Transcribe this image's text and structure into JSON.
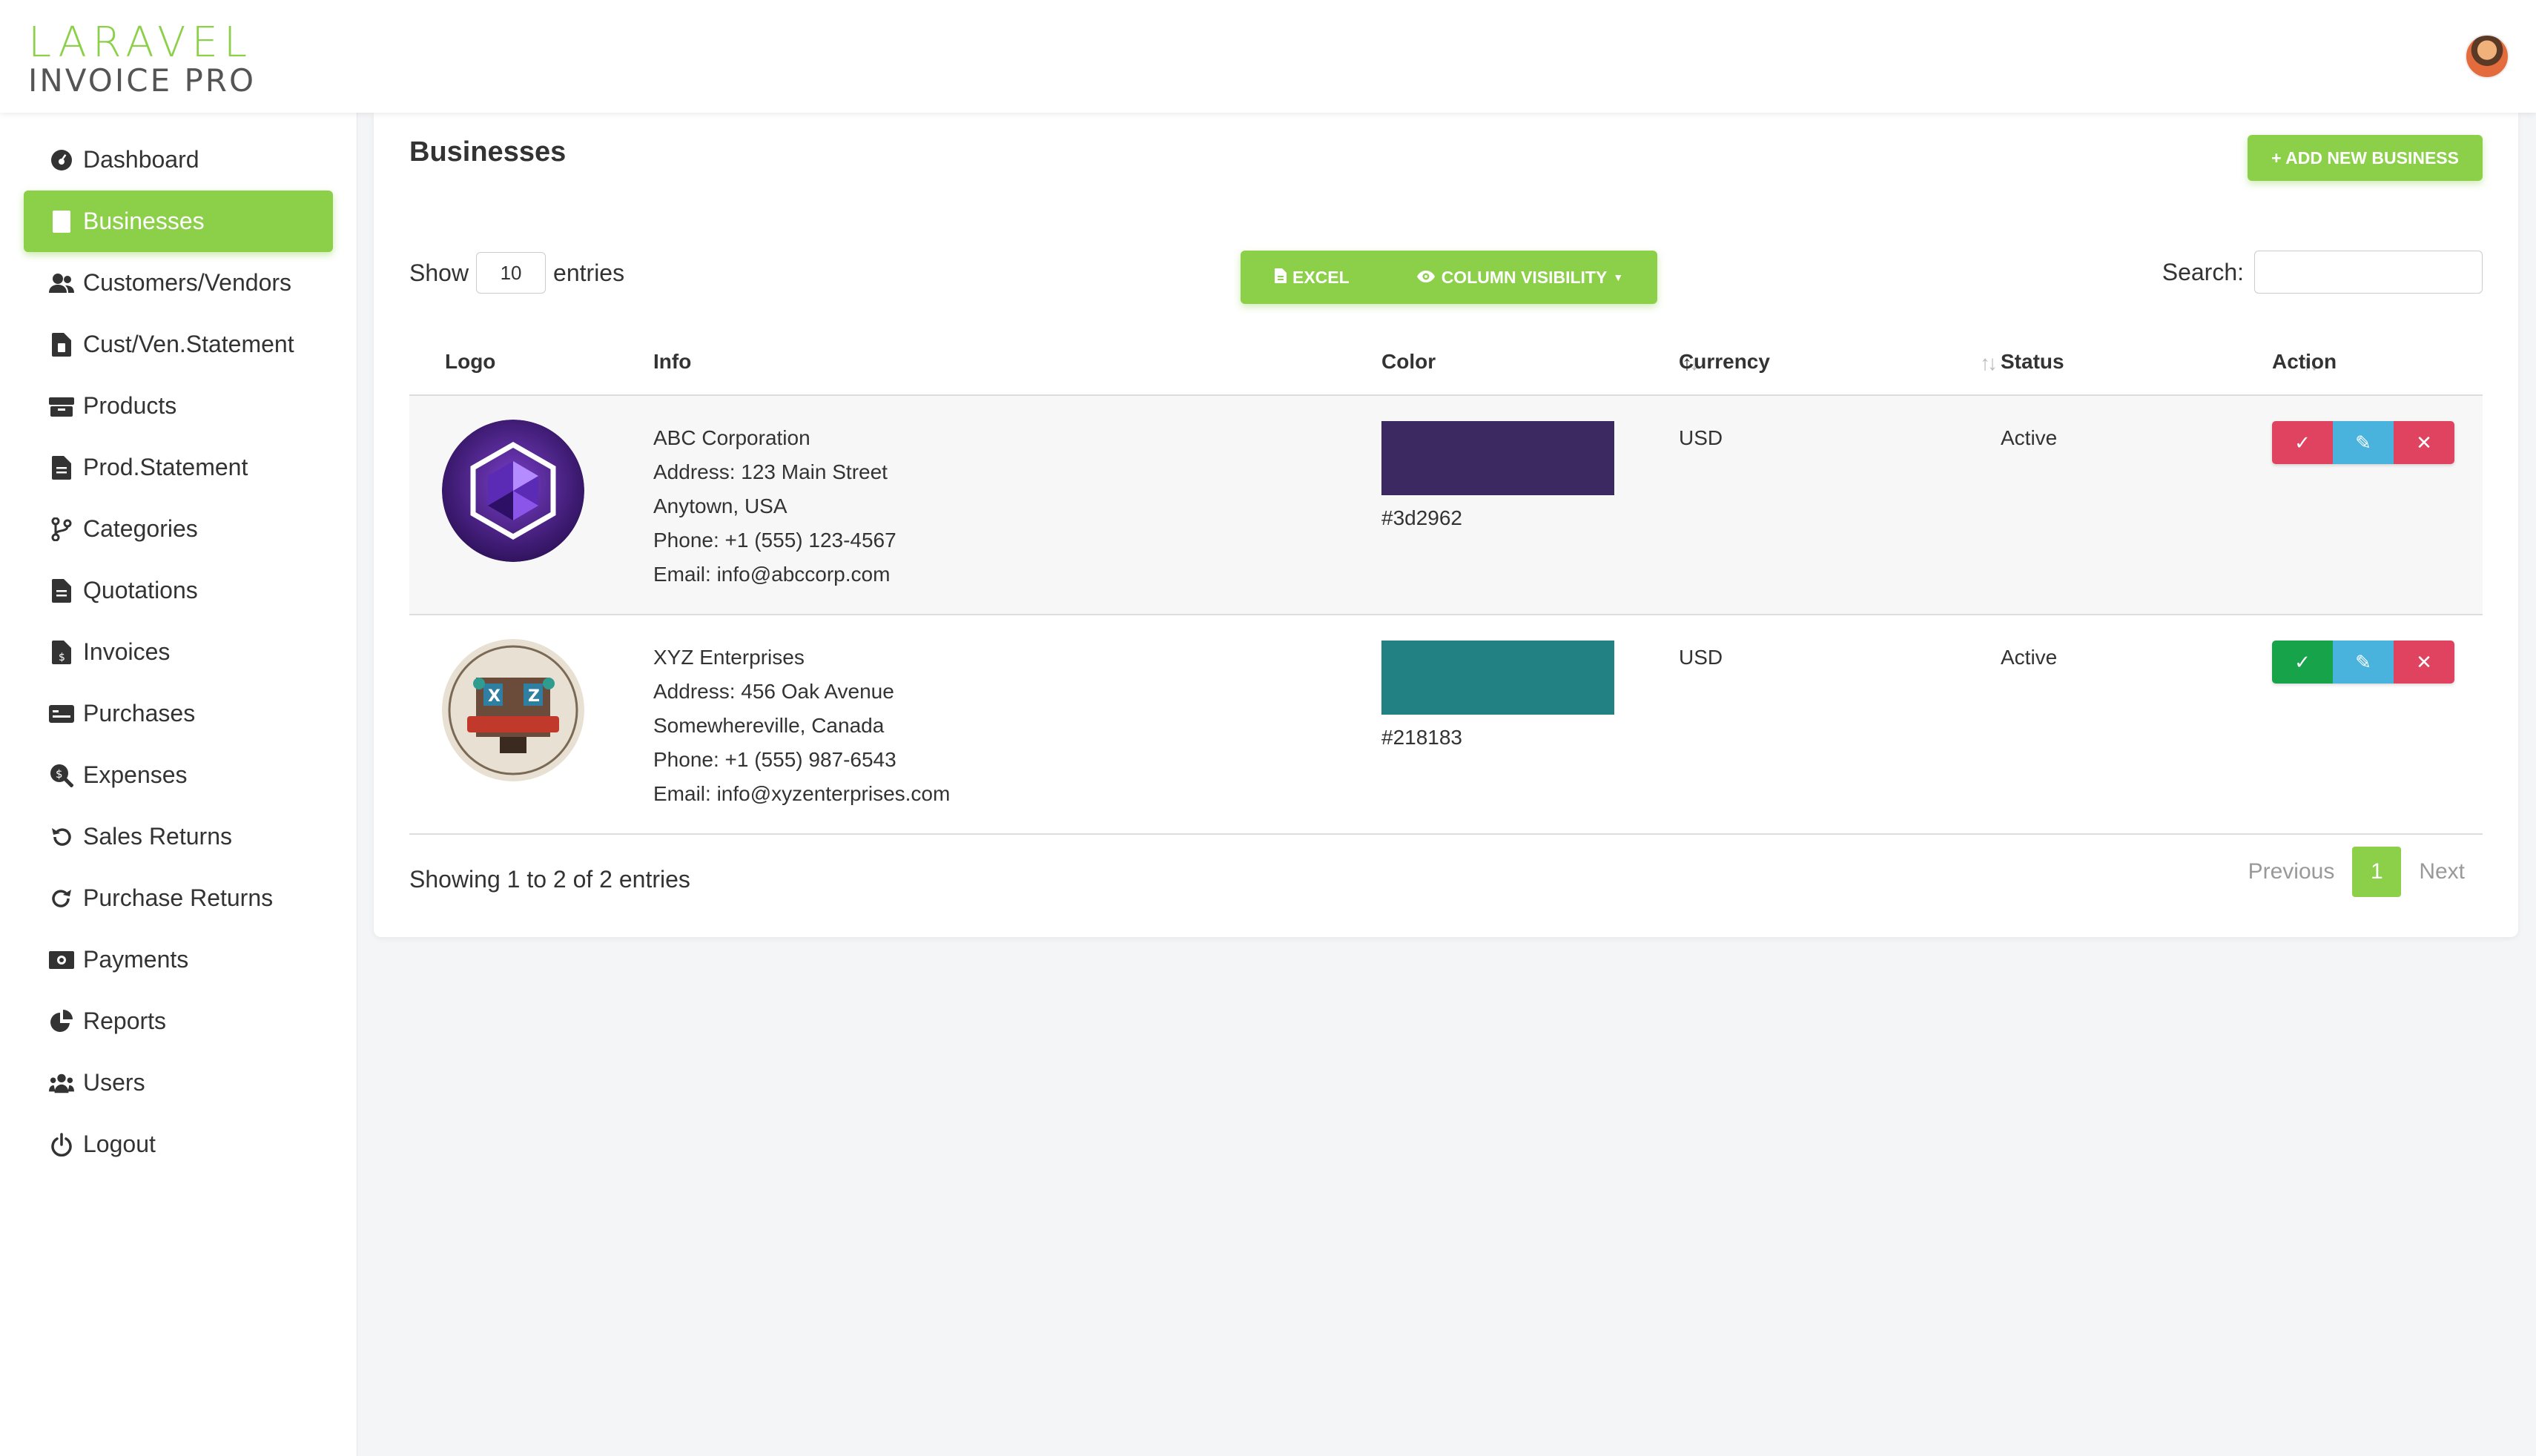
{
  "app": {
    "logo_line1": "LARAVEL",
    "logo_line2": "INVOICE PRO",
    "brand_color": "#8cd04a"
  },
  "sidebar": {
    "items": [
      {
        "label": "Dashboard",
        "icon": "dashboard-icon",
        "active": false
      },
      {
        "label": "Businesses",
        "icon": "building-icon",
        "active": true
      },
      {
        "label": "Customers/Vendors",
        "icon": "users-icon",
        "active": false
      },
      {
        "label": "Cust/Ven.Statement",
        "icon": "file-invoice-icon",
        "active": false
      },
      {
        "label": "Products",
        "icon": "boxes-icon",
        "active": false
      },
      {
        "label": "Prod.Statement",
        "icon": "file-alt-icon",
        "active": false
      },
      {
        "label": "Categories",
        "icon": "code-branch-icon",
        "active": false
      },
      {
        "label": "Quotations",
        "icon": "file-alt-icon",
        "active": false
      },
      {
        "label": "Invoices",
        "icon": "file-invoice-dollar-icon",
        "active": false
      },
      {
        "label": "Purchases",
        "icon": "money-check-icon",
        "active": false
      },
      {
        "label": "Expenses",
        "icon": "search-dollar-icon",
        "active": false
      },
      {
        "label": "Sales Returns",
        "icon": "undo-icon",
        "active": false
      },
      {
        "label": "Purchase Returns",
        "icon": "redo-icon",
        "active": false
      },
      {
        "label": "Payments",
        "icon": "money-bill-icon",
        "active": false
      },
      {
        "label": "Reports",
        "icon": "chart-pie-icon",
        "active": false
      },
      {
        "label": "Users",
        "icon": "users-cog-icon",
        "active": false
      },
      {
        "label": "Logout",
        "icon": "power-icon",
        "active": false
      }
    ]
  },
  "main": {
    "title": "Businesses",
    "add_button": "+ ADD NEW BUSINESS",
    "show_label": "Show",
    "entries_label": "entries",
    "page_length": "10",
    "excel_button": "EXCEL",
    "column_visibility_button": "COLUMN VISIBILITY",
    "search_label": "Search:",
    "search_value": ""
  },
  "table": {
    "columns": [
      "Logo",
      "Info",
      "Color",
      "Currency",
      "Status",
      "Action"
    ],
    "rows": [
      {
        "name": "ABC Corporation",
        "address": "Address: 123 Main Street",
        "city": "Anytown, USA",
        "phone": "Phone: +1 (555) 123-4567",
        "email": "Email: info@abccorp.com",
        "color": "#3d2962",
        "currency": "USD",
        "status": "Active",
        "toggle_color": "#e0435f"
      },
      {
        "name": "XYZ Enterprises",
        "address": "Address: 456 Oak Avenue",
        "city": "Somewhereville, Canada",
        "phone": "Phone: +1 (555) 987-6543",
        "email": "Email: info@xyzenterprises.com",
        "color": "#218183",
        "currency": "USD",
        "status": "Active",
        "toggle_color": "#16a34a"
      }
    ]
  },
  "footer": {
    "info": "Showing 1 to 2 of 2 entries",
    "previous": "Previous",
    "current_page": "1",
    "next": "Next"
  }
}
